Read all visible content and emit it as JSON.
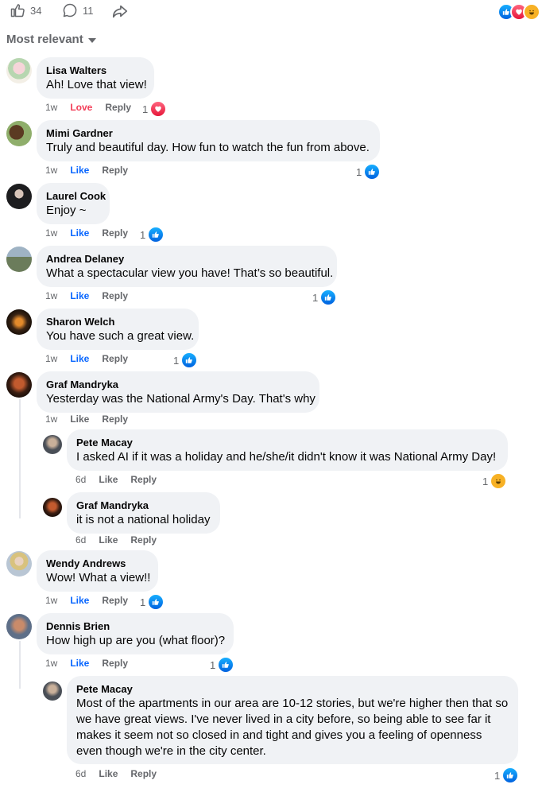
{
  "top": {
    "like_count": "34",
    "comment_count": "11",
    "sort_label": "Most relevant"
  },
  "colors": {
    "like": "#0866ff",
    "love": "#f33e58",
    "muted": "#65676b",
    "bubble": "#f0f2f5"
  },
  "comments": [
    {
      "name": "Lisa Walters",
      "text": "Ah! Love that view!",
      "time": "1w",
      "reaction_label": "Love",
      "reply": "Reply",
      "count": "1",
      "reaction_icon": "love-icon"
    },
    {
      "name": "Mimi Gardner",
      "text": "Truly and beautiful day. How fun to watch the fun from above.",
      "time": "1w",
      "reaction_label": "Like",
      "reply": "Reply",
      "count": "1",
      "reaction_icon": "like-icon"
    },
    {
      "name": "Laurel Cook",
      "text": "Enjoy ~",
      "time": "1w",
      "reaction_label": "Like",
      "reply": "Reply",
      "count": "1",
      "reaction_icon": "like-icon"
    },
    {
      "name": "Andrea Delaney",
      "text": "What a spectacular view you have! That’s so beautiful.",
      "time": "1w",
      "reaction_label": "Like",
      "reply": "Reply",
      "count": "1",
      "reaction_icon": "like-icon"
    },
    {
      "name": "Sharon Welch",
      "text": "You have such a great view.",
      "time": "1w",
      "reaction_label": "Like",
      "reply": "Reply",
      "count": "1",
      "reaction_icon": "like-icon"
    },
    {
      "name": "Graf Mandryka",
      "text": "Yesterday was the National Army's Day. That's why",
      "time": "1w",
      "reaction_label": "Like",
      "reply": "Reply"
    },
    {
      "name": "Pete Macay",
      "text": "I asked AI if it was a holiday and he/she/it didn't know it was National Army Day!",
      "time": "6d",
      "reaction_label": "Like",
      "reply": "Reply",
      "count": "1",
      "reaction_icon": "haha-icon"
    },
    {
      "name": "Graf Mandryka",
      "text": "it is not a national holiday",
      "time": "6d",
      "reaction_label": "Like",
      "reply": "Reply"
    },
    {
      "name": "Wendy Andrews",
      "text": "Wow! What a view!!",
      "time": "1w",
      "reaction_label": "Like",
      "reply": "Reply",
      "count": "1",
      "reaction_icon": "like-icon"
    },
    {
      "name": "Dennis Brien",
      "text": "How high up are you (what floor)?",
      "time": "1w",
      "reaction_label": "Like",
      "reply": "Reply",
      "count": "1",
      "reaction_icon": "like-icon"
    },
    {
      "name": "Pete Macay",
      "text": "Most of the apartments in our area are 10-12 stories, but we're higher then that so we have great views. I've never lived in a city before, so being able to see far it makes it seem not so closed in and tight and gives you a feeling of openness even though we're in the city center.",
      "time": "6d",
      "reaction_label": "Like",
      "reply": "Reply",
      "count": "1",
      "reaction_icon": "like-icon"
    }
  ]
}
